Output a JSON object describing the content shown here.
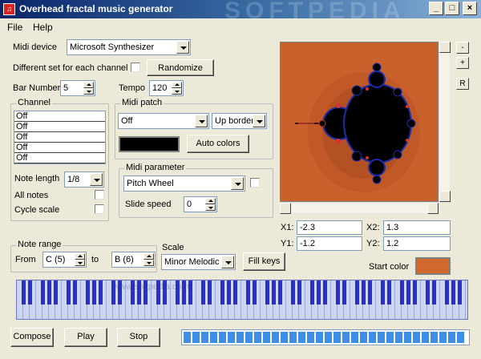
{
  "window": {
    "title": "Overhead fractal music generator",
    "watermark": "SOFTPEDIA",
    "icon_label": "♫",
    "controls": {
      "minimize": "_",
      "maximize": "□",
      "close": "×"
    }
  },
  "menu": {
    "file": "File",
    "help": "Help"
  },
  "midi_device": {
    "label": "Midi device",
    "value": "Microsoft Synthesizer"
  },
  "diff_channel": {
    "label": "Different set for each channel",
    "checked": false
  },
  "randomize_label": "Randomize",
  "bar_number": {
    "label": "Bar Number",
    "value": "5"
  },
  "tempo": {
    "label": "Tempo",
    "value": "120"
  },
  "channel": {
    "title": "Channel",
    "rows": [
      "Off",
      "Off",
      "Off",
      "Off",
      "Off"
    ]
  },
  "midi_patch": {
    "title": "Midi patch",
    "patch_value": "Off",
    "border_value": "Up border",
    "swatch_color": "#000000",
    "auto_colors_label": "Auto colors"
  },
  "note_length": {
    "label": "Note length",
    "value": "1/8"
  },
  "all_notes": {
    "label": "All notes",
    "checked": false
  },
  "cycle_scale": {
    "label": "Cycle scale",
    "checked": false
  },
  "midi_parameter": {
    "title": "Midi parameter",
    "value": "Pitch Wheel",
    "slide_speed_label": "Slide speed",
    "slide_speed_value": "0"
  },
  "coords": {
    "x1_label": "X1:",
    "x1": "-2.3",
    "x2_label": "X2:",
    "x2": "1.3",
    "y1_label": "Y1:",
    "y1": "-1.2",
    "y2_label": "Y2:",
    "y2": "1.2"
  },
  "zoom": {
    "minus": "-",
    "plus": "+",
    "reset": "R"
  },
  "note_range": {
    "title": "Note range",
    "from_label": "From",
    "from_value": "C  (5)",
    "to_label": "to",
    "to_value": "B  (6)"
  },
  "scale": {
    "label": "Scale",
    "value": "Minor Melodic"
  },
  "fill_keys_label": "Fill keys",
  "start_color": {
    "label": "Start color",
    "color": "#d2692e"
  },
  "piano_watermark": "www.softpedia.com",
  "buttons": {
    "compose": "Compose",
    "play": "Play",
    "stop": "Stop"
  },
  "progress": {
    "fraction": 1.0
  },
  "fractal_colors": {
    "background": "#c8612c",
    "set": "#000000",
    "edge": "#1a2fb0",
    "glow": "#d83030"
  }
}
